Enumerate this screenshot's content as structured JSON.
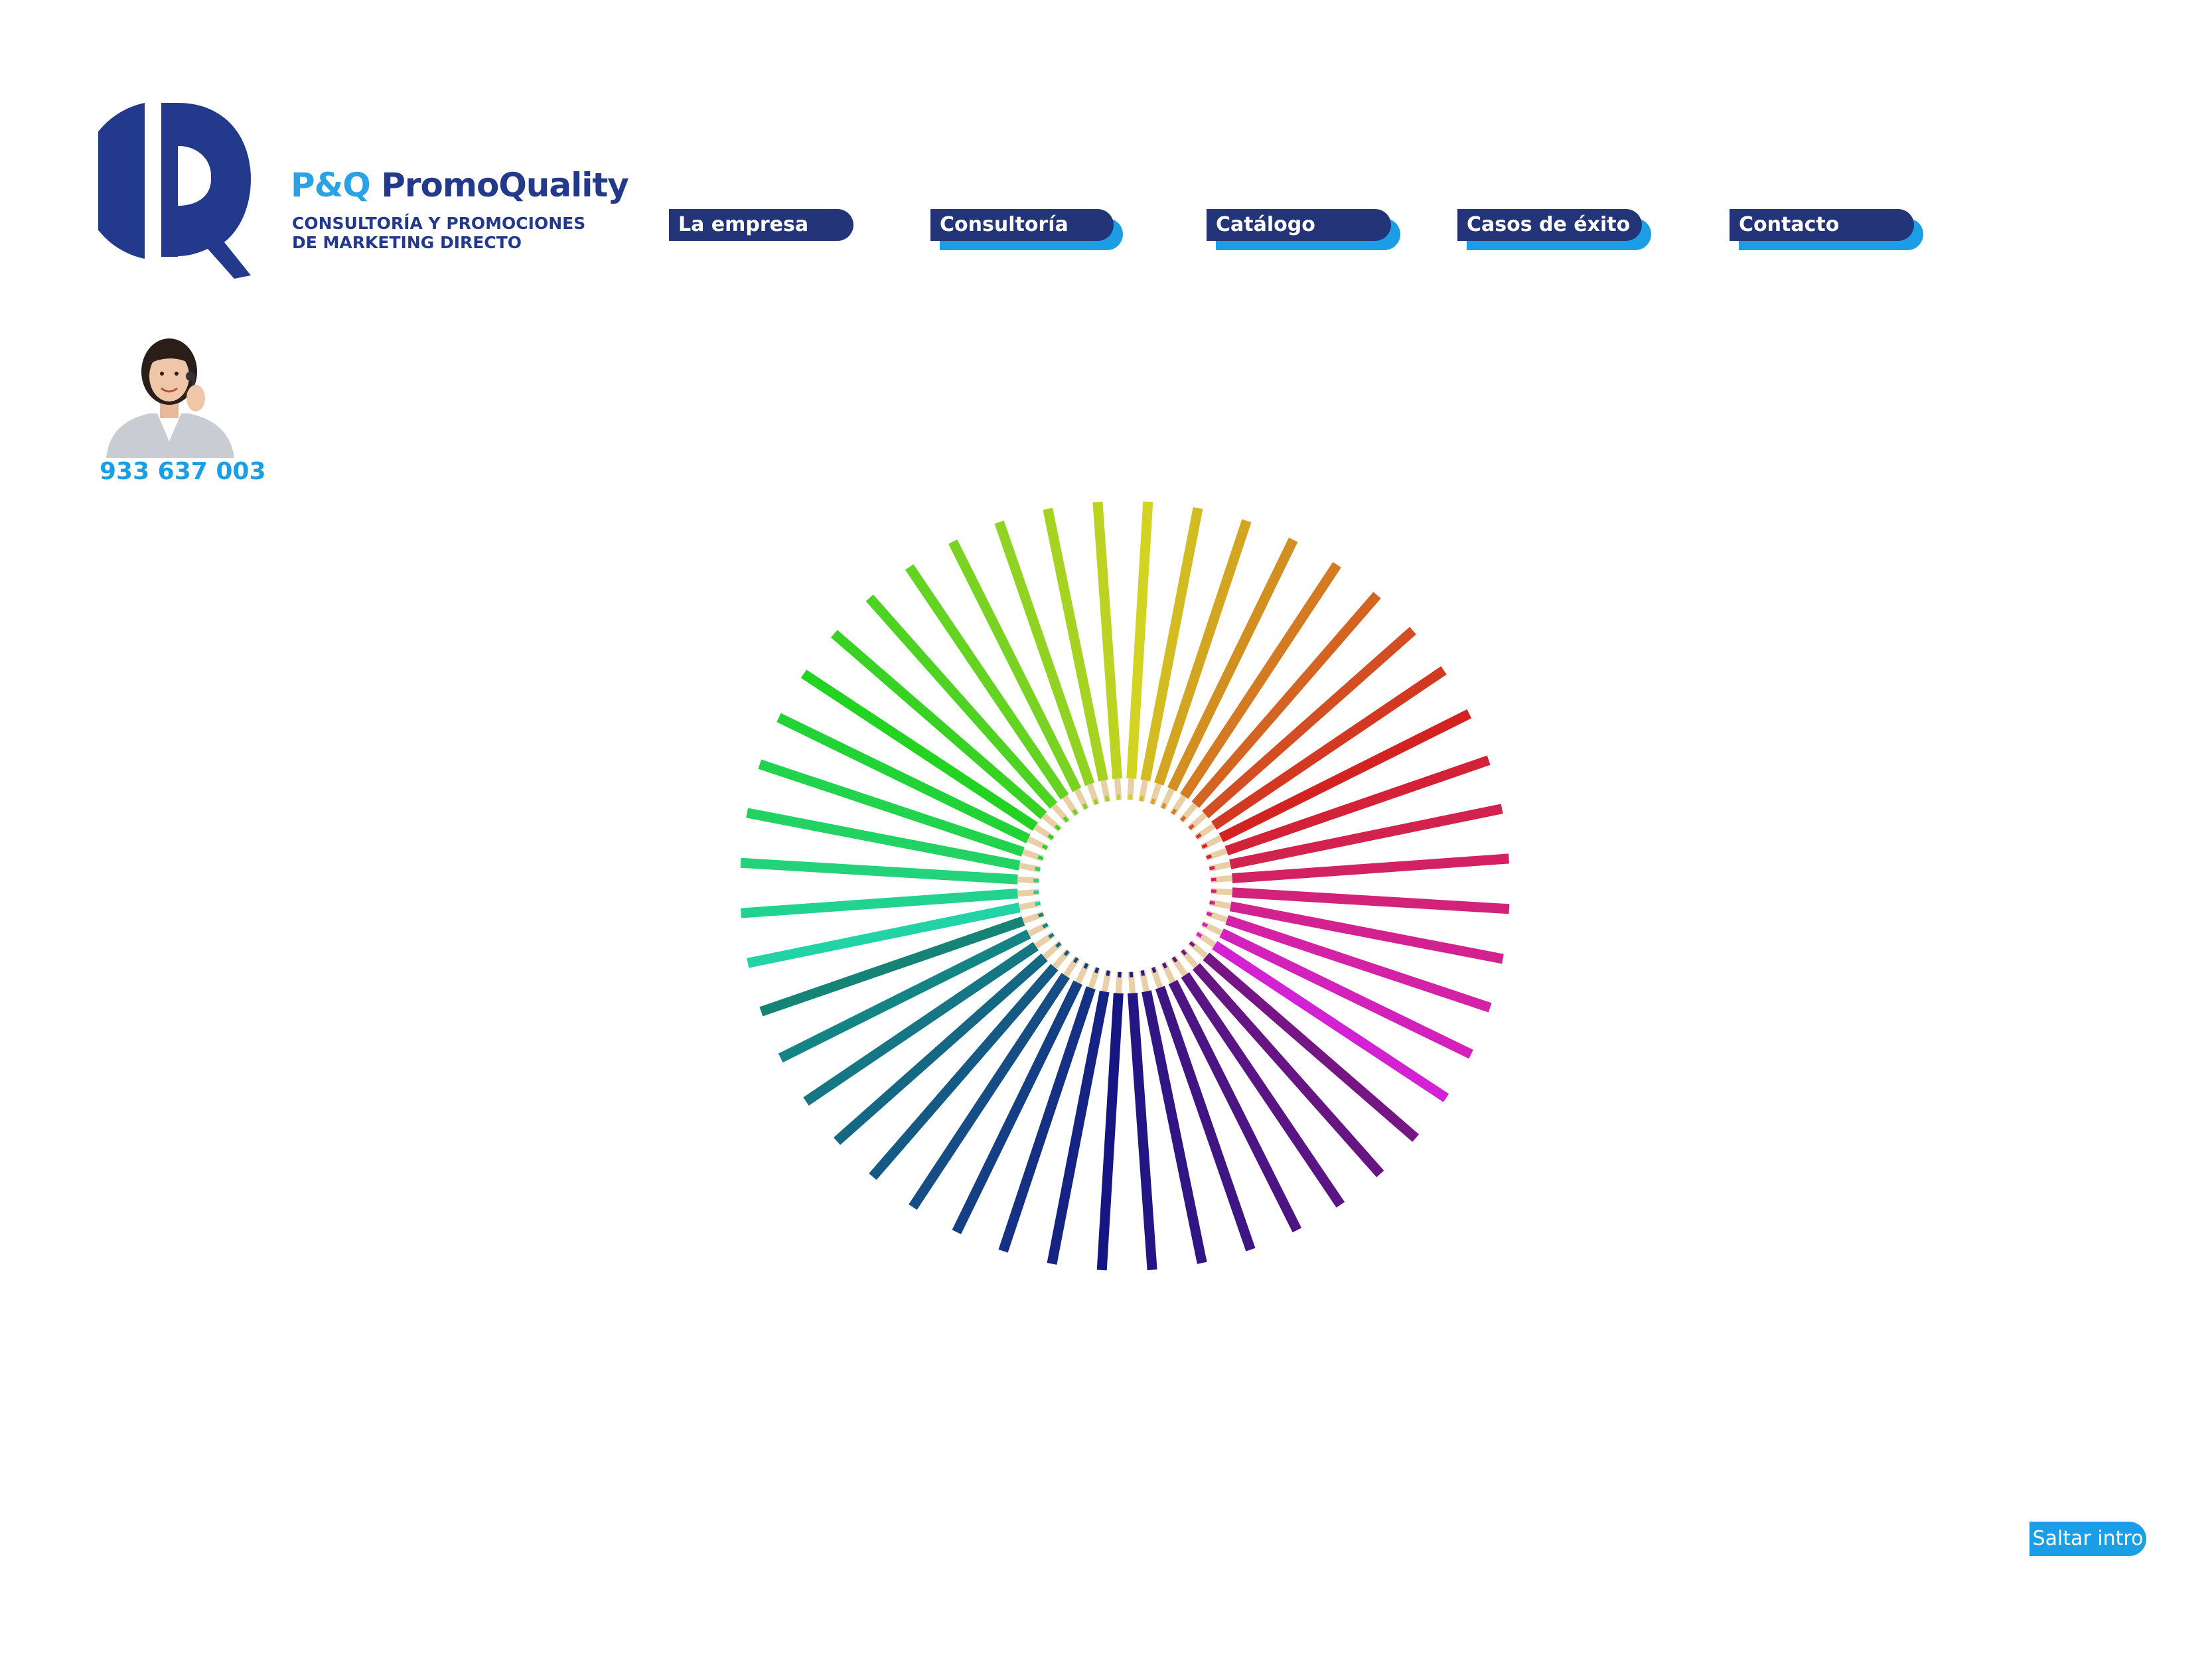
{
  "brand": {
    "logo_letter": "P",
    "name_prefix": "P&Q",
    "name_main": "PromoQuality",
    "tagline_line1": "CONSULTORÍA Y PROMOCIONES",
    "tagline_line2": "DE MARKETING DIRECTO",
    "colors": {
      "dark_blue": "#233a8c",
      "light_blue": "#2aa3e6"
    }
  },
  "nav": {
    "items": [
      {
        "label": "La empresa"
      },
      {
        "label": "Consultoría"
      },
      {
        "label": "Catálogo"
      },
      {
        "label": "Casos de éxito"
      },
      {
        "label": "Contacto"
      }
    ]
  },
  "contact": {
    "phone": "933 637 003",
    "photo_icon": "operator-with-headset"
  },
  "hero": {
    "image": "colored-pencils-wheel"
  },
  "skip_intro": {
    "label": "Saltar intro"
  }
}
